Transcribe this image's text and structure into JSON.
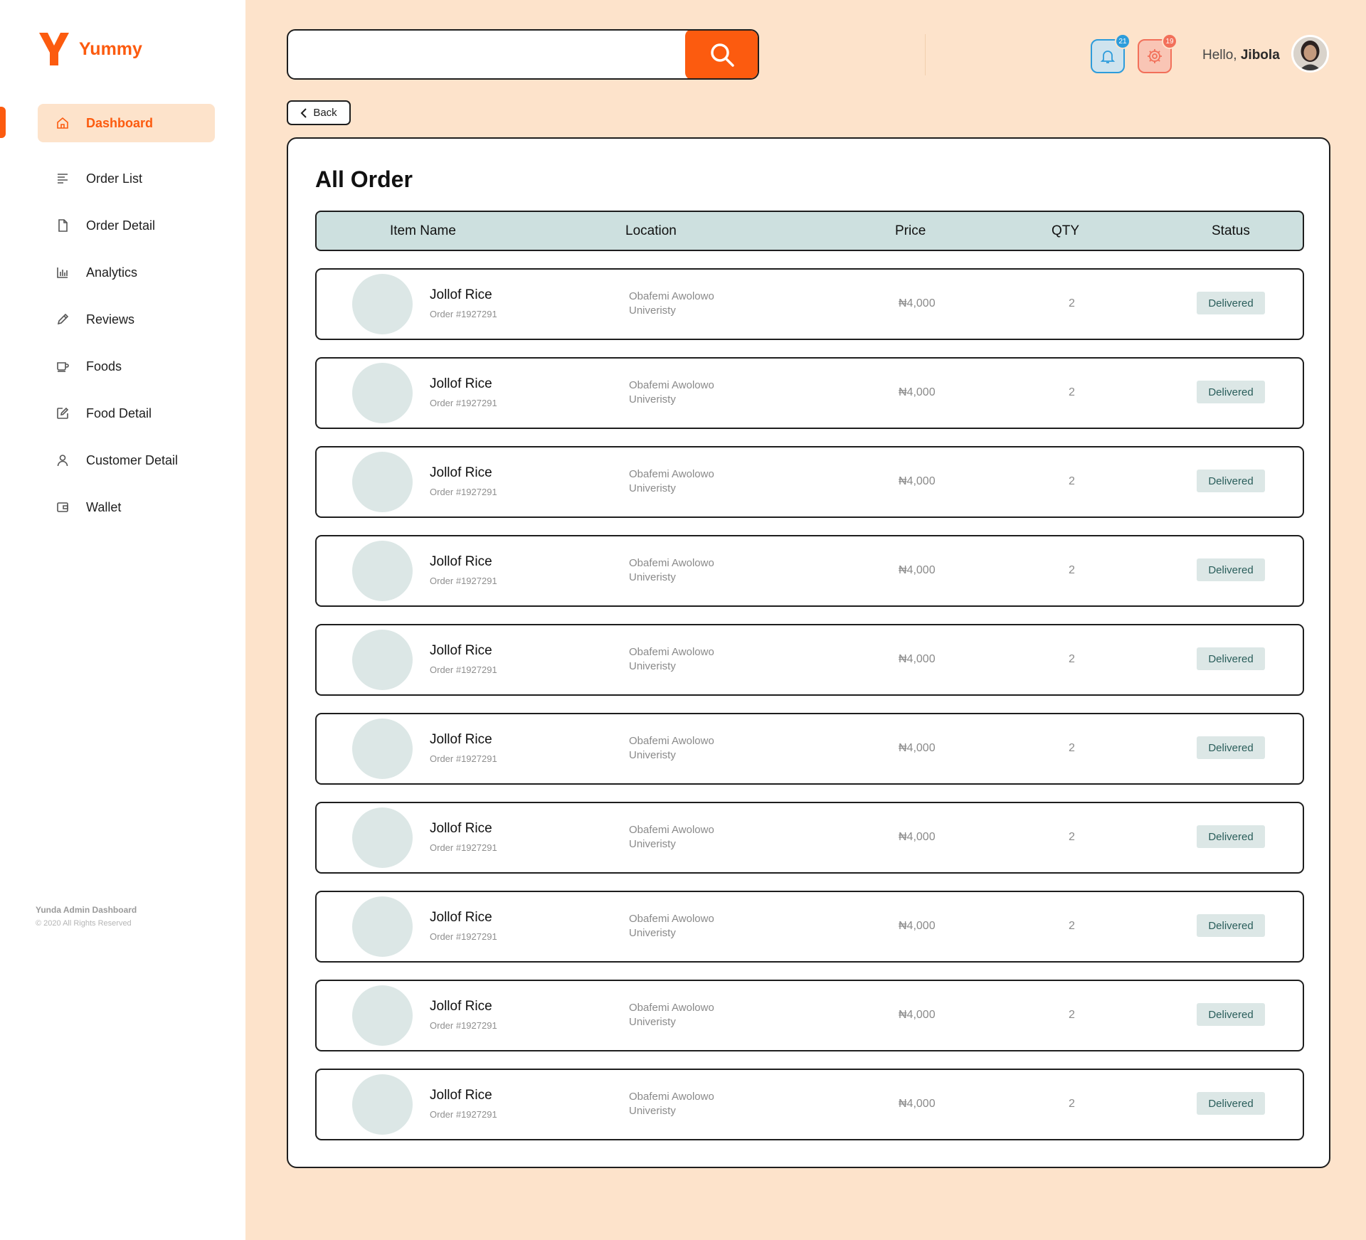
{
  "brand": {
    "name": "Yummy",
    "color": "#fc5b0f"
  },
  "sidebar": {
    "items": [
      {
        "label": "Dashboard",
        "icon": "home-icon",
        "active": true
      },
      {
        "label": "Order List",
        "icon": "list-icon"
      },
      {
        "label": "Order Detail",
        "icon": "document-icon"
      },
      {
        "label": "Analytics",
        "icon": "bar-chart-icon"
      },
      {
        "label": "Reviews",
        "icon": "pencil-icon"
      },
      {
        "label": "Foods",
        "icon": "cup-icon"
      },
      {
        "label": "Food Detail",
        "icon": "edit-icon"
      },
      {
        "label": "Customer Detail",
        "icon": "user-icon"
      },
      {
        "label": "Wallet",
        "icon": "wallet-icon"
      }
    ],
    "footer": {
      "title": "Yunda Admin Dashboard",
      "copyright": "© 2020 All Rights Reserved"
    }
  },
  "header": {
    "search": {
      "placeholder": "",
      "value": ""
    },
    "notifications": {
      "icon": "bell-icon",
      "count": "21",
      "color": "#2d9cdb"
    },
    "settings": {
      "icon": "gear-icon",
      "count": "19",
      "color": "#f2705a"
    },
    "greeting": {
      "hello": "Hello,",
      "name": "Jibola"
    }
  },
  "back_label": "Back",
  "main": {
    "title": "All Order",
    "columns": [
      "Item Name",
      "Location",
      "Price",
      "QTY",
      "Status"
    ],
    "rows": [
      {
        "name": "Jollof Rice",
        "order": "Order #1927291",
        "location": "Obafemi Awolowo Univeristy",
        "price": "₦4,000",
        "qty": "2",
        "status": "Delivered"
      },
      {
        "name": "Jollof Rice",
        "order": "Order #1927291",
        "location": "Obafemi Awolowo Univeristy",
        "price": "₦4,000",
        "qty": "2",
        "status": "Delivered"
      },
      {
        "name": "Jollof Rice",
        "order": "Order #1927291",
        "location": "Obafemi Awolowo Univeristy",
        "price": "₦4,000",
        "qty": "2",
        "status": "Delivered"
      },
      {
        "name": "Jollof Rice",
        "order": "Order #1927291",
        "location": "Obafemi Awolowo Univeristy",
        "price": "₦4,000",
        "qty": "2",
        "status": "Delivered"
      },
      {
        "name": "Jollof Rice",
        "order": "Order #1927291",
        "location": "Obafemi Awolowo Univeristy",
        "price": "₦4,000",
        "qty": "2",
        "status": "Delivered"
      },
      {
        "name": "Jollof Rice",
        "order": "Order #1927291",
        "location": "Obafemi Awolowo Univeristy",
        "price": "₦4,000",
        "qty": "2",
        "status": "Delivered"
      },
      {
        "name": "Jollof Rice",
        "order": "Order #1927291",
        "location": "Obafemi Awolowo Univeristy",
        "price": "₦4,000",
        "qty": "2",
        "status": "Delivered"
      },
      {
        "name": "Jollof Rice",
        "order": "Order #1927291",
        "location": "Obafemi Awolowo Univeristy",
        "price": "₦4,000",
        "qty": "2",
        "status": "Delivered"
      },
      {
        "name": "Jollof Rice",
        "order": "Order #1927291",
        "location": "Obafemi Awolowo Univeristy",
        "price": "₦4,000",
        "qty": "2",
        "status": "Delivered"
      },
      {
        "name": "Jollof Rice",
        "order": "Order #1927291",
        "location": "Obafemi Awolowo Univeristy",
        "price": "₦4,000",
        "qty": "2",
        "status": "Delivered"
      }
    ]
  }
}
